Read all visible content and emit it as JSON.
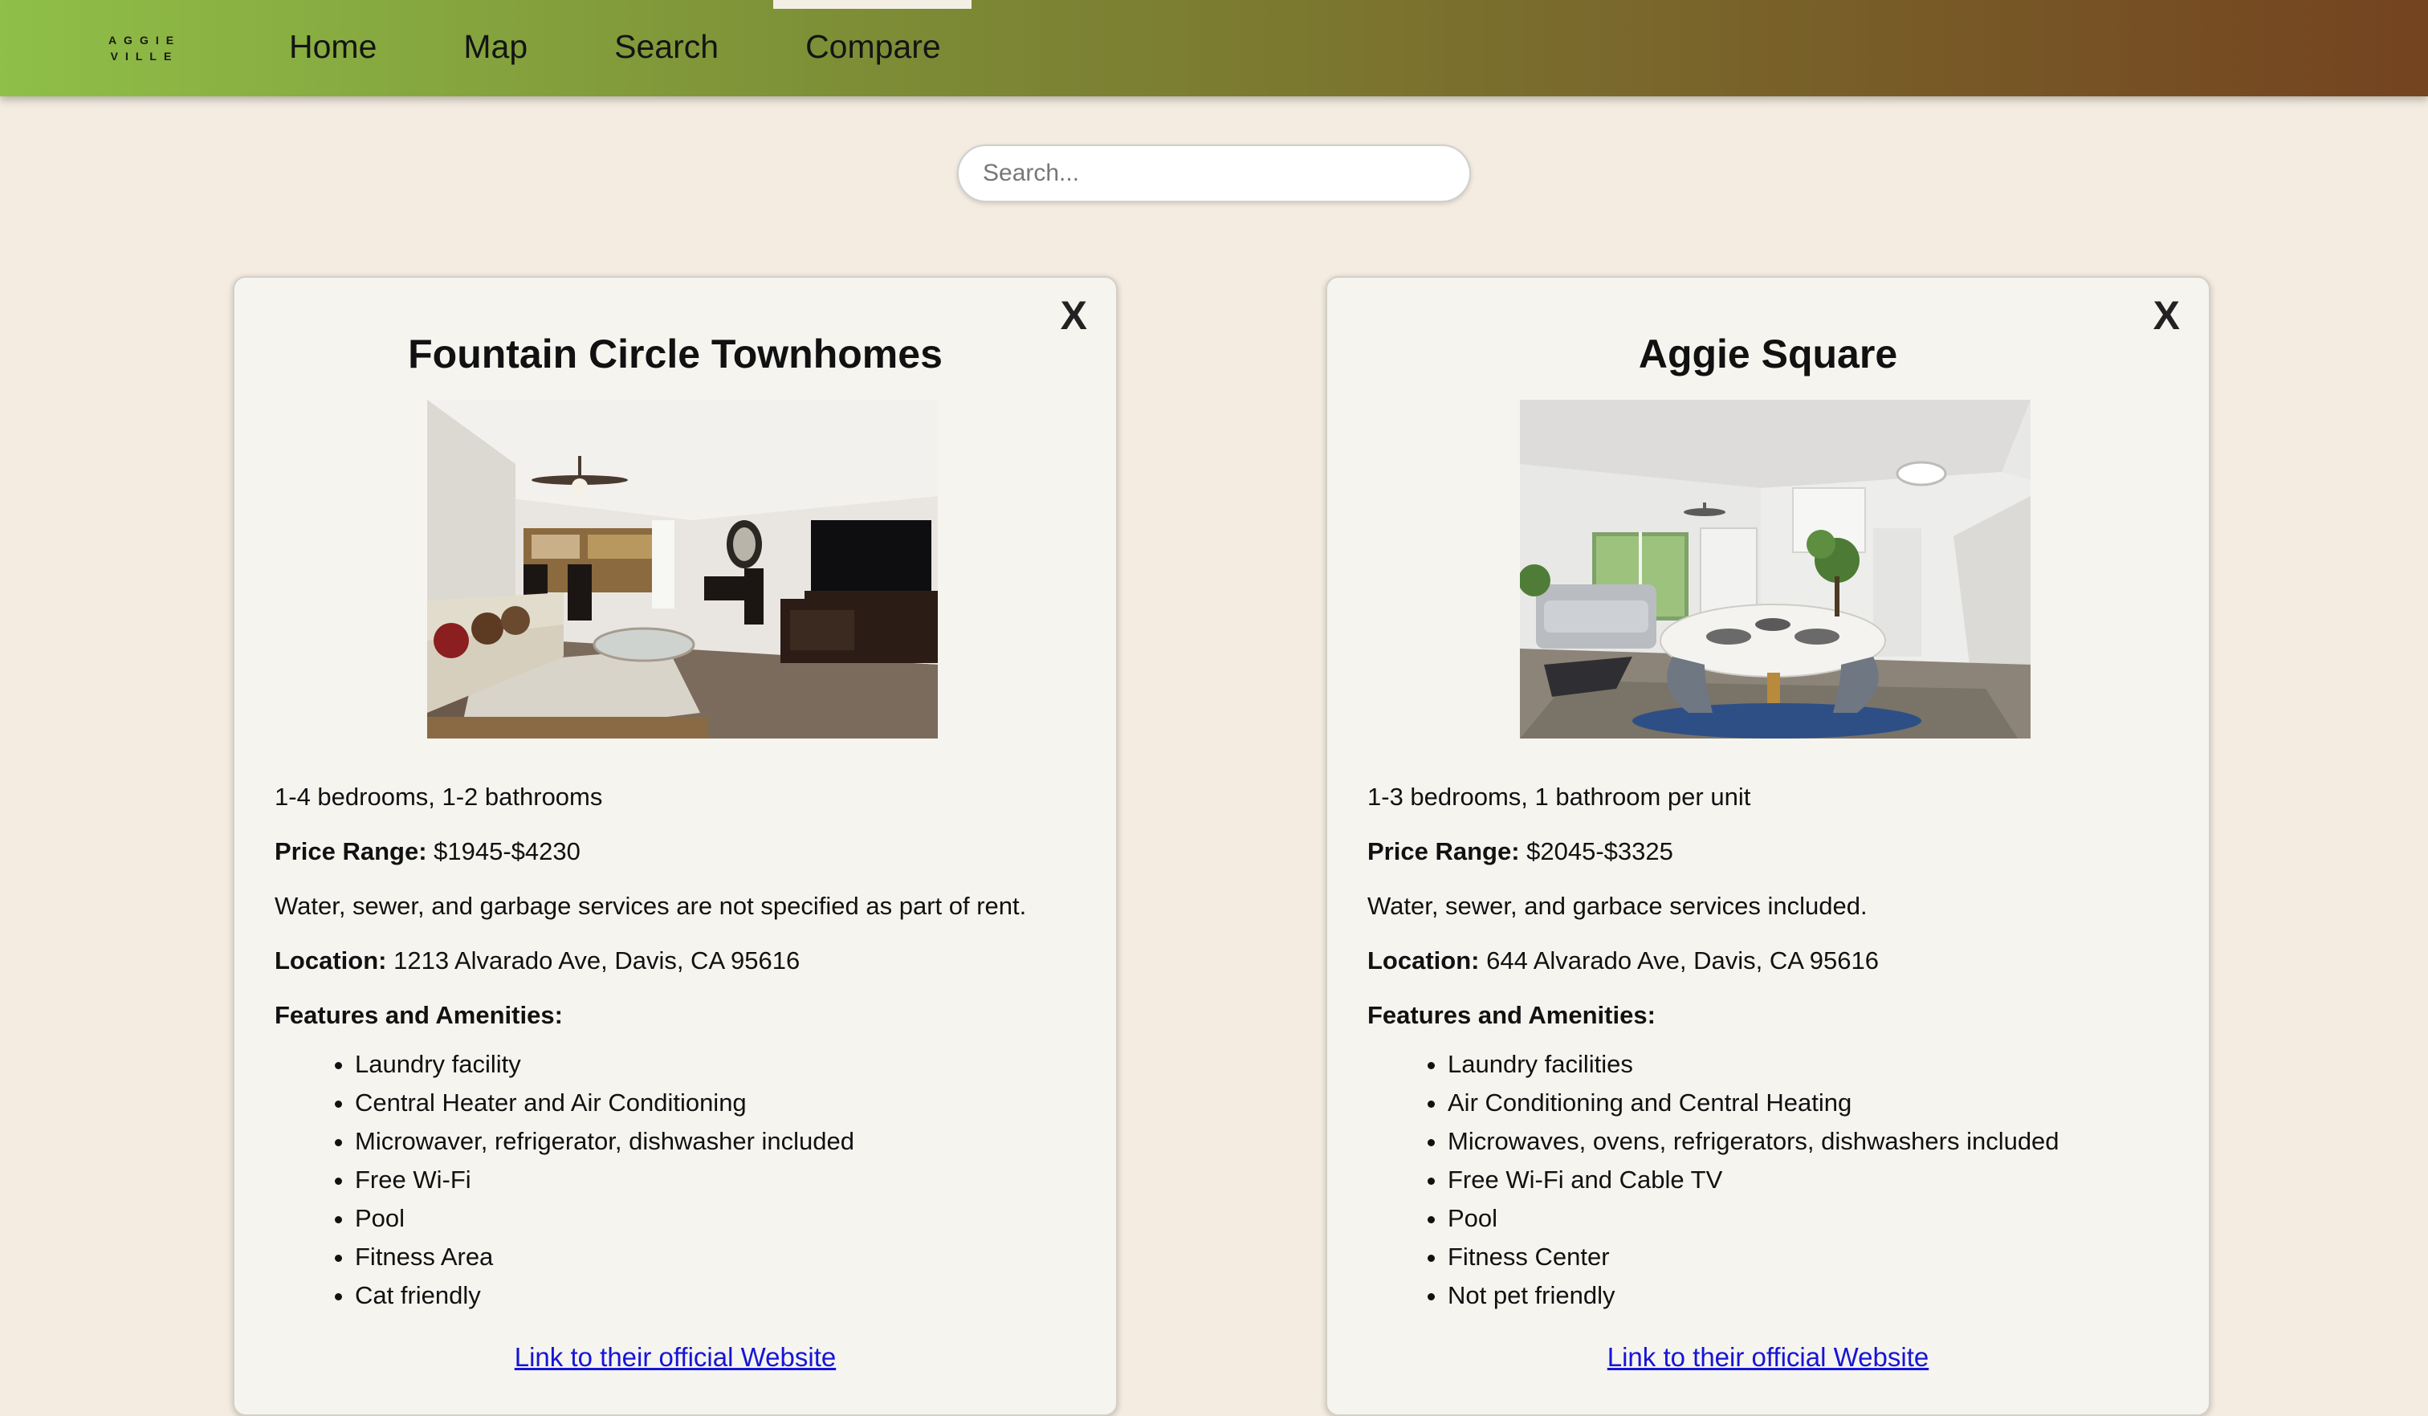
{
  "logo": {
    "line1": "AGGIE",
    "line2": "VILLE"
  },
  "nav": {
    "items": [
      {
        "label": "Home"
      },
      {
        "label": "Map"
      },
      {
        "label": "Search"
      },
      {
        "label": "Compare"
      }
    ],
    "active": "Compare"
  },
  "search": {
    "placeholder": "Search..."
  },
  "cards": [
    {
      "close_label": "X",
      "title": "Fountain Circle Townhomes",
      "rooms": "1-4 bedrooms, 1-2 bathrooms",
      "price_label": "Price Range:",
      "price": " $1945-$4230",
      "utilities": "Water, sewer, and garbage services are not specified as part of rent.",
      "location_label": "Location:",
      "location": " 1213 Alvarado Ave, Davis, CA 95616",
      "features_label": "Features and Amenities:",
      "features": [
        "Laundry facility",
        "Central Heater and Air Conditioning",
        "Microwaver, refrigerator, dishwasher included",
        "Free Wi-Fi",
        "Pool",
        "Fitness Area",
        "Cat friendly"
      ],
      "link_label": "Link to their official Website"
    },
    {
      "close_label": "X",
      "title": "Aggie Square",
      "rooms": "1-3 bedrooms, 1 bathroom per unit",
      "price_label": "Price Range:",
      "price": " $2045-$3325",
      "utilities": "Water, sewer, and garbace services included.",
      "location_label": "Location:",
      "location": " 644 Alvarado Ave, Davis, CA 95616",
      "features_label": "Features and Amenities:",
      "features": [
        "Laundry facilities",
        "Air Conditioning and Central Heating",
        "Microwaves, ovens, refrigerators, dishwashers included",
        "Free Wi-Fi and Cable TV",
        "Pool",
        "Fitness Center",
        "Not pet friendly"
      ],
      "link_label": "Link to their official Website"
    }
  ]
}
